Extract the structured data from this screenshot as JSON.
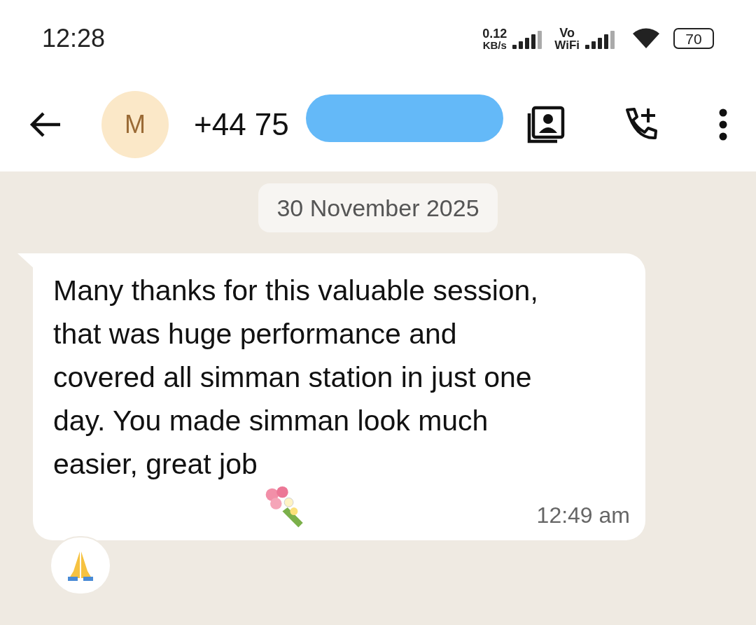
{
  "status_bar": {
    "time": "12:28",
    "speed_value": "0.12",
    "speed_unit": "KB/s",
    "volte_top": "Vo",
    "volte_bottom": "WiFi",
    "battery": "70"
  },
  "header": {
    "avatar_letter": "M",
    "contact": "+44 75"
  },
  "date_chip": "30 November 2025",
  "message": {
    "text": "Many thanks for this valuable session, that was huge performance and covered all simman station in just one day. You made simman look much easier, great job",
    "time": "12:49 am"
  }
}
